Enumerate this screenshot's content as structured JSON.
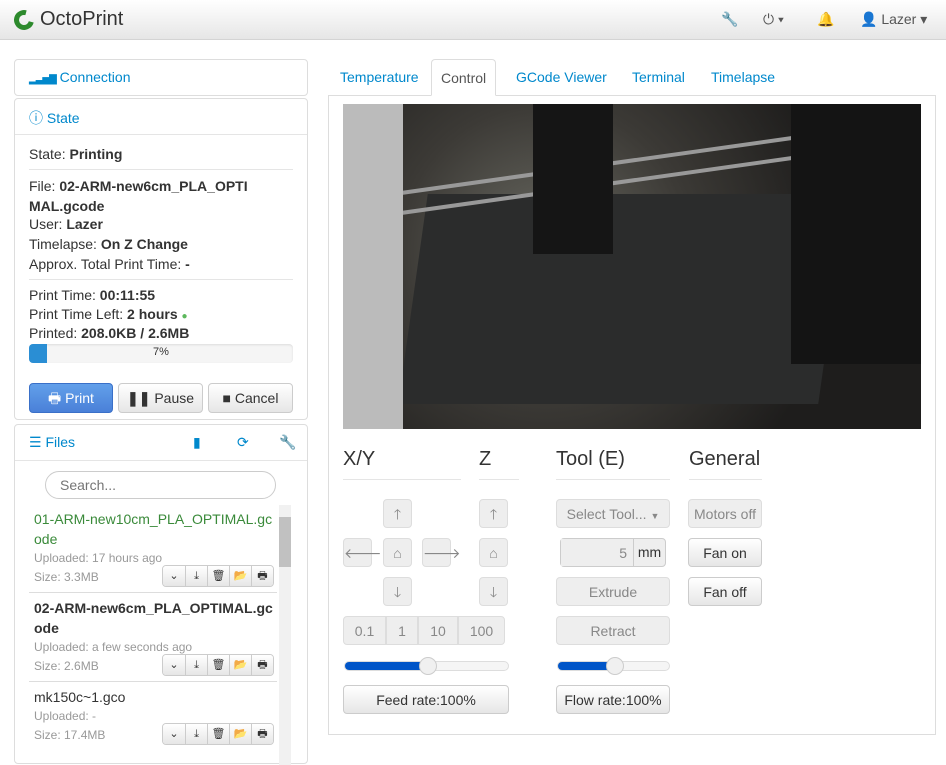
{
  "nav": {
    "brand": "OctoPrint",
    "user": "Lazer"
  },
  "connection": {
    "title": "Connection"
  },
  "state": {
    "title": "State",
    "state_label": "State:",
    "state_value": "Printing",
    "file_label": "File:",
    "file_value": "02-ARM-new6cm_PLA_OPTIMAL.gcode",
    "user_label": "User:",
    "user_value": "Lazer",
    "timelapse_label": "Timelapse:",
    "timelapse_value": "On Z Change",
    "approx_label": "Approx. Total Print Time:",
    "approx_value": "-",
    "print_time_label": "Print Time:",
    "print_time_value": "00:11:55",
    "time_left_label": "Print Time Left:",
    "time_left_value": "2 hours",
    "printed_label": "Printed:",
    "printed_value": "208.0KB / 2.6MB",
    "progress_text": "7%",
    "progress": 7,
    "print_btn": "Print",
    "pause_btn": "Pause",
    "cancel_btn": "Cancel"
  },
  "files": {
    "title": "Files",
    "search_placeholder": "Search...",
    "items": [
      {
        "name": "01-ARM-new10cm_PLA_OPTIMAL.gcode",
        "uploaded": "Uploaded: 17 hours ago",
        "size": "Size: 3.3MB"
      },
      {
        "name": "02-ARM-new6cm_PLA_OPTIMAL.gcode",
        "uploaded": "Uploaded: a few seconds ago",
        "size": "Size: 2.6MB"
      },
      {
        "name": "mk150c~1.gco",
        "uploaded": "Uploaded: -",
        "size": "Size: 17.4MB"
      }
    ]
  },
  "tabs": [
    "Temperature",
    "Control",
    "GCode Viewer",
    "Terminal",
    "Timelapse"
  ],
  "control": {
    "xy": "X/Y",
    "z": "Z",
    "tool": "Tool (E)",
    "general": "General",
    "steps": [
      "0.1",
      "1",
      "10",
      "100"
    ],
    "select_tool": "Select Tool...",
    "extrude_amount": "5",
    "unit": "mm",
    "extrude": "Extrude",
    "retract": "Retract",
    "motors_off": "Motors off",
    "fan_on": "Fan on",
    "fan_off": "Fan off",
    "feed_rate": "Feed rate:100%",
    "flow_rate": "Flow rate:100%",
    "feed_slider": 100,
    "flow_slider": 100
  }
}
